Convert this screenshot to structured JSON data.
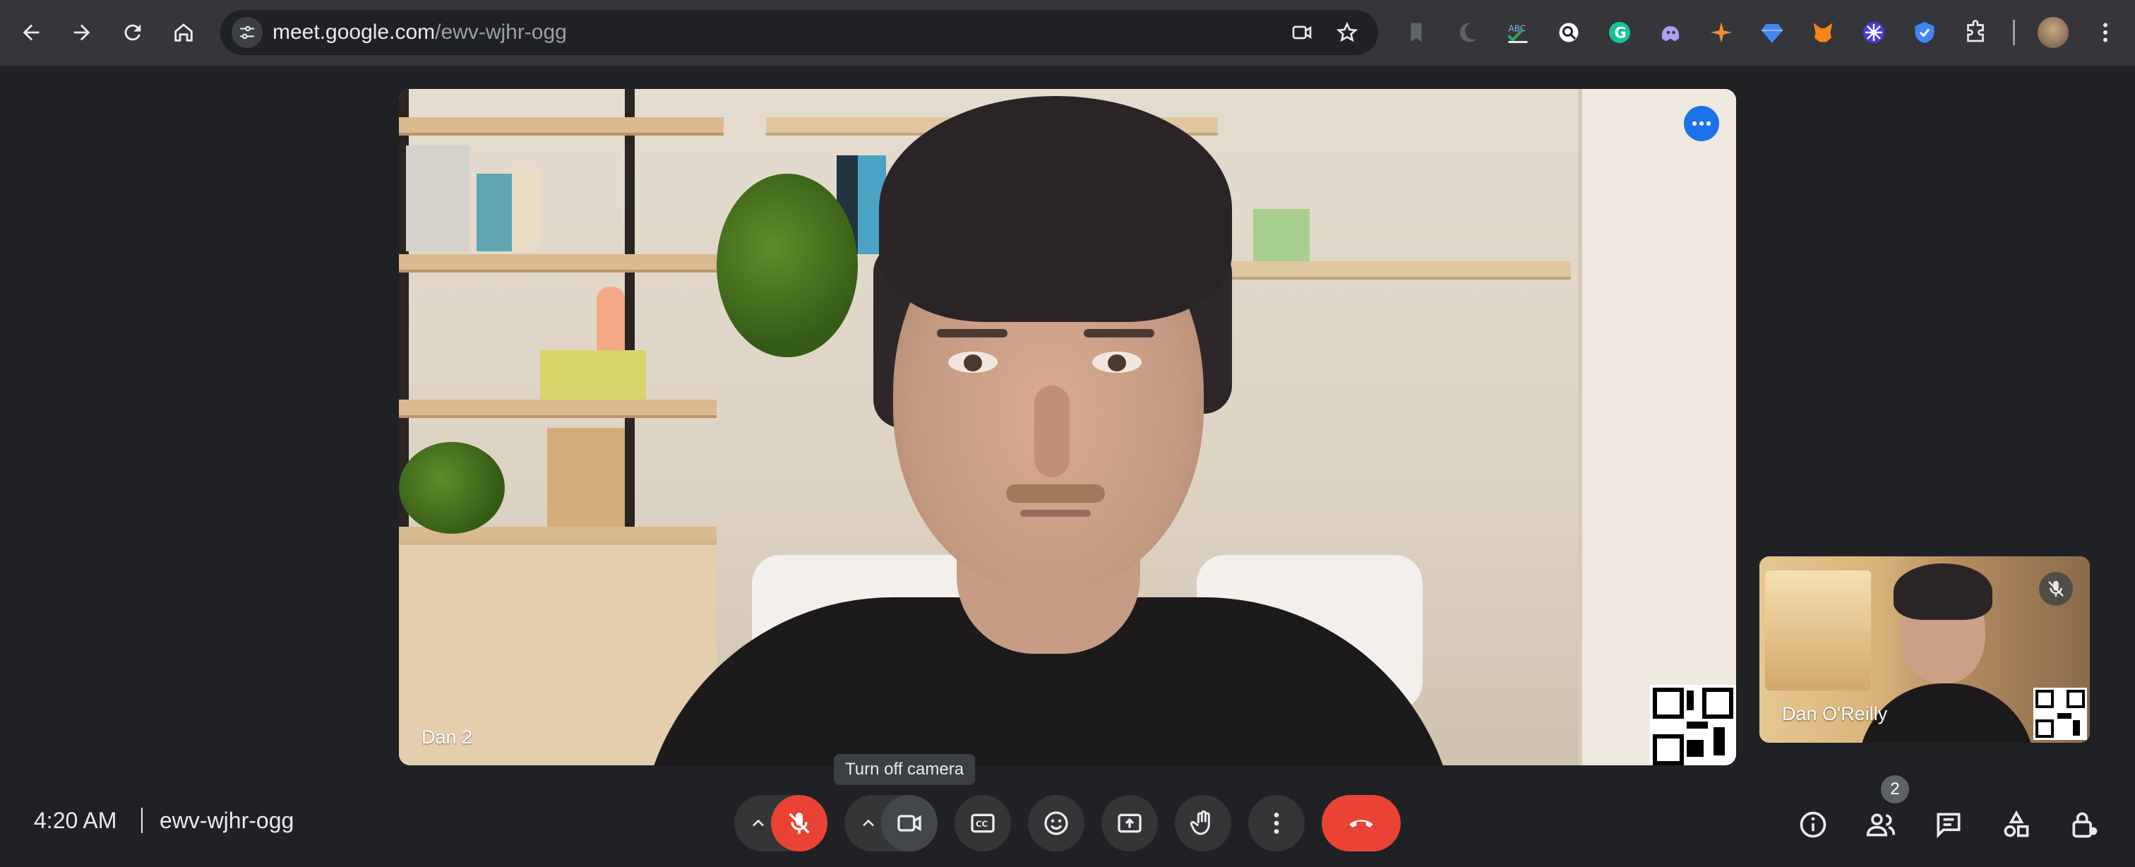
{
  "browser": {
    "url_host": "meet.google.com",
    "url_path": "/ewv-wjhr-ogg"
  },
  "main_tile": {
    "participant_label": "Dan 2"
  },
  "self_tile": {
    "participant_label": "Dan O'Reilly"
  },
  "controls": {
    "tooltip": "Turn off camera"
  },
  "footer": {
    "time": "4:20 AM",
    "meeting_code": "ewv-wjhr-ogg",
    "participant_count": "2"
  },
  "colors": {
    "accent_blue": "#1a73e8",
    "danger_red": "#ea4335",
    "background": "#202124"
  }
}
